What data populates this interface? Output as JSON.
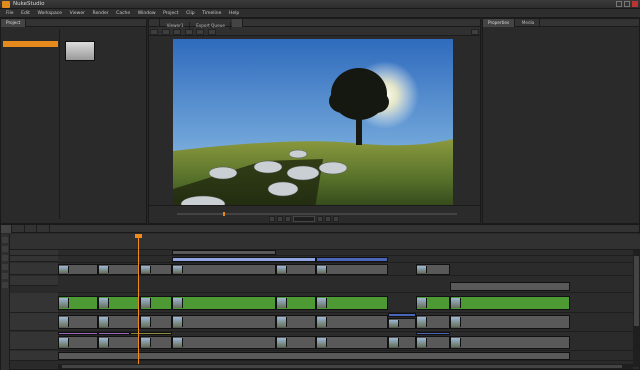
{
  "window": {
    "title": "NukeStudio"
  },
  "menu": [
    "File",
    "Edit",
    "Workspace",
    "Viewer",
    "Render",
    "Cache",
    "Window",
    "Project",
    "Clip",
    "Timeline",
    "Help"
  ],
  "project_panel": {
    "tab": "Project",
    "tree": [
      {
        "label": "",
        "selected": false
      },
      {
        "label": "",
        "selected": false
      },
      {
        "label": "",
        "selected": true
      },
      {
        "label": "",
        "selected": false
      },
      {
        "label": "",
        "selected": false
      },
      {
        "label": "",
        "selected": false
      },
      {
        "label": "",
        "selected": false
      },
      {
        "label": "",
        "selected": false
      }
    ],
    "bin_item": {
      "name": ""
    }
  },
  "viewer_tabs": [
    {
      "label": "",
      "active": false
    },
    {
      "label": "Viewer1",
      "active": false
    },
    {
      "label": "Export Queue",
      "active": false
    },
    {
      "label": "",
      "active": true
    }
  ],
  "right_tabs": [
    {
      "label": "Properties",
      "active": true
    },
    {
      "label": "Media",
      "active": false
    }
  ],
  "viewer": {
    "toolbar": [
      "",
      "",
      "",
      "",
      "",
      ""
    ],
    "zoom_readout": "",
    "timecodes": [
      "",
      "",
      "",
      "",
      "",
      "",
      "",
      "",
      "",
      "",
      ""
    ],
    "transport_left": "",
    "transport_right": ""
  },
  "timeline_tabs": [
    {
      "label": "",
      "active": true
    },
    {
      "label": "",
      "active": false
    },
    {
      "label": "",
      "active": false
    },
    {
      "label": "",
      "active": false
    }
  ],
  "timeline": {
    "timecode": "",
    "ruler": [
      "",
      "",
      "",
      "",
      "",
      "",
      "",
      "",
      "",
      "",
      "",
      "",
      "",
      "",
      "",
      "",
      "",
      "",
      "",
      ""
    ],
    "tracks": [
      {
        "name": ""
      },
      {
        "name": ""
      },
      {
        "name": ""
      },
      {
        "name": ""
      },
      {
        "name": ""
      },
      {
        "name": ""
      },
      {
        "name": ""
      },
      {
        "name": ""
      }
    ]
  },
  "colors": {
    "accent": "#e68a1e",
    "green_clip": "#4d9a35",
    "blue_clip": "#4a64b8",
    "purple_clip": "#9a67b7"
  }
}
